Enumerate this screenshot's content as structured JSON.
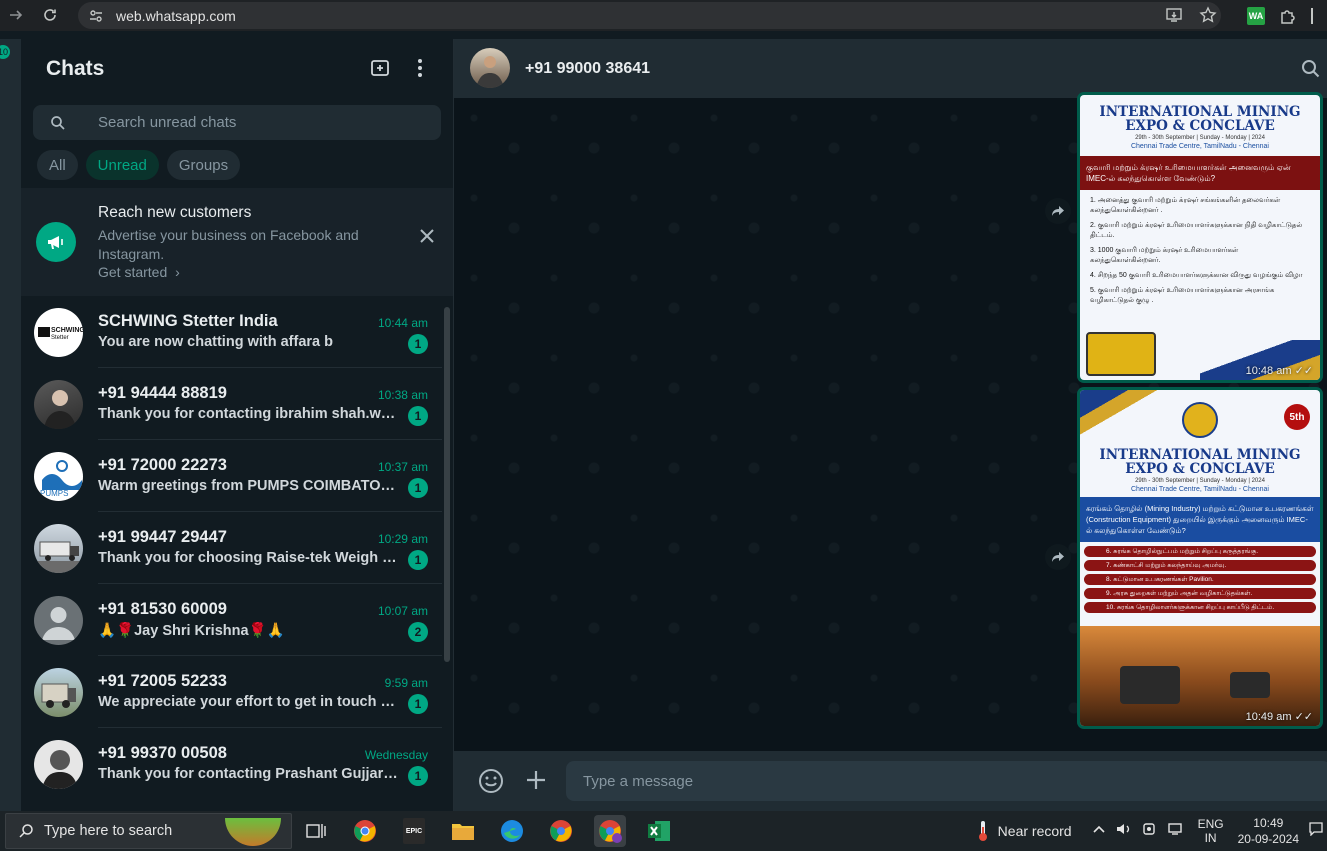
{
  "browser": {
    "url": "web.whatsapp.com",
    "extension_label": "WA"
  },
  "sidebar": {
    "badge": "10"
  },
  "chat_panel": {
    "title": "Chats",
    "search_placeholder": "Search unread chats",
    "filters": [
      {
        "label": "All",
        "active": false
      },
      {
        "label": "Unread",
        "active": true
      },
      {
        "label": "Groups",
        "active": false
      }
    ],
    "promo": {
      "title": "Reach new customers",
      "text": "Advertise your business on Facebook and Instagram.",
      "link": "Get started"
    },
    "chats": [
      {
        "name": "SCHWING Stetter India",
        "time": "10:44 am",
        "message": "You are now chatting with affara b",
        "unread": "1",
        "avatar": "schwing-logo"
      },
      {
        "name": "+91 94444 88819",
        "time": "10:38 am",
        "message": "Thank you for contacting ibrahim shah.we wil…",
        "unread": "1",
        "avatar": "person-photo"
      },
      {
        "name": "+91 72000 22273",
        "time": "10:37 am",
        "message": "Warm greetings from PUMPS COIMBATORE P…",
        "unread": "1",
        "avatar": "pumps-logo"
      },
      {
        "name": "+91 99447 29447",
        "time": "10:29 am",
        "message": "Thank you for choosing Raise-tek Weigh Syst…",
        "unread": "1",
        "avatar": "truck-photo"
      },
      {
        "name": "+91 81530 60009",
        "time": "10:07 am",
        "message": "🙏🌹Jay Shri Krishna🌹🙏",
        "unread": "2",
        "avatar": "default-avatar"
      },
      {
        "name": "+91 72005 52233",
        "time": "9:59 am",
        "message": "We appreciate your effort to get in touch wit…",
        "unread": "1",
        "avatar": "machine-photo"
      },
      {
        "name": "+91 99370 00508",
        "time": "Wednesday",
        "message": "Thank you for contacting Prashant Gujjar 😊 …",
        "unread": "1",
        "avatar": "person-photo-bw"
      }
    ]
  },
  "conversation": {
    "title": "+91 99000 38641",
    "messages": [
      {
        "time": "10:48 am",
        "poster_title_1": "INTERNATIONAL MINING",
        "poster_title_2": "EXPO & CONCLAVE",
        "poster_dates": "29th - 30th September | Sunday - Monday | 2024",
        "poster_venue": "Chennai Trade Centre, TamilNadu - Chennai",
        "band": "குவாரி மற்றும் க்ரஷர் உரிமையாளர்கள் அனைவரும் ஏன் IMEC-ல் கலந்துகொள்ள வேண்டும்?",
        "points": [
          "1. அனைத்து குவாரி மற்றும் க்ரஷர் சங்கங்களின் தலைவர்கள் கலந்துகொள்கின்றனர் .",
          "2. குவாரி மற்றும் க்ரஷர் உரிமையாளர்களுக்கான நிதி வழிகாட்டுதல் திட்டம்.",
          "3. 1000 குவாரி மற்றும் க்ரஷர் உரிமையாளர்கள் கலந்துகொள்கின்றனர்.",
          "4. சிறந்த 50 குவாரி உரிமையாளர்களுக்கான விருது வழங்கும் விழா",
          "5. குவாரி மற்றும் க்ரஷர் உரிமையாளர்களுக்கான அரசாங்க வழிகாட்டுதல் குழு ."
        ]
      },
      {
        "time": "10:49 am",
        "edition": "5th",
        "poster_title_1": "INTERNATIONAL MINING",
        "poster_title_2": "EXPO & CONCLAVE",
        "poster_dates": "29th - 30th September | Sunday - Monday | 2024",
        "poster_venue": "Chennai Trade Centre, TamilNadu - Chennai",
        "band": "சுரங்கம் தொழில் (Mining Industry) மற்றும் கட்டுமான உபகரணங்கள் (Construction Equipment) துறையில் இருக்கும் அனைவரும் IMEC-ல் கலந்துகொள்ள வேண்டும்?",
        "bars": [
          "6. சுரங்க தொழில்நுட்பம் மற்றும் சிறப்பு கருத்தரங்கு.",
          "7. கண்காட்சி மற்றும் கலந்தாய்வு அமர்வு.",
          "8. கட்டுமான உபகரணங்கள் Pavilion.",
          "9. அரசு துறைகள் மற்றும் அதன் வழிகாட்டுதல்கள்.",
          "10. சுரங்க தொழிலாளர்களுக்கான சிறப்பு காப்பீடு திட்டம்."
        ]
      }
    ],
    "composer_placeholder": "Type a message"
  },
  "taskbar": {
    "search_placeholder": "Type here to search",
    "weather": "Near record",
    "lang_1": "ENG",
    "lang_2": "IN",
    "time": "10:49",
    "date": "20-09-2024"
  },
  "colors": {
    "accent": "#00a884",
    "panel": "#111b21",
    "header": "#202c33",
    "bubble_out": "#005c4b"
  }
}
